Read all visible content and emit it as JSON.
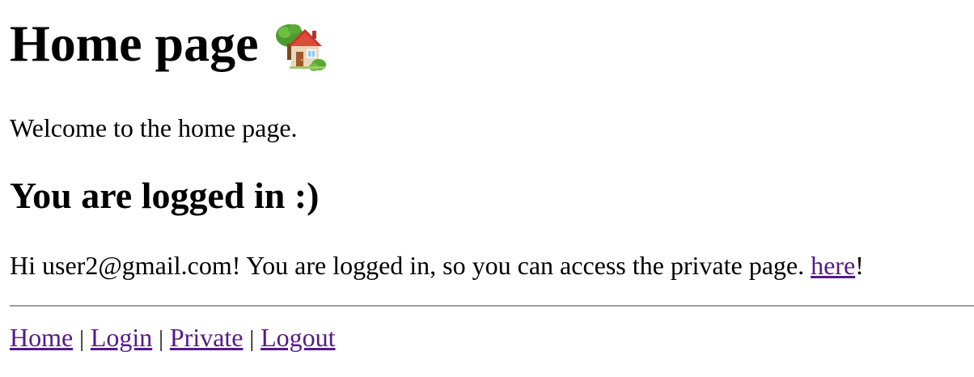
{
  "page": {
    "title": "Home page",
    "title_icon": "house-with-garden-icon",
    "intro": "Welcome to the home page.",
    "status_heading": "You are logged in :)",
    "greeting_before": "Hi user2@gmail.com! You are logged in, so you can access the private page. ",
    "greeting_link": "here",
    "greeting_after": "!"
  },
  "footer": {
    "links": [
      {
        "label": "Home"
      },
      {
        "label": "Login"
      },
      {
        "label": "Private"
      },
      {
        "label": "Logout"
      }
    ],
    "separator": "|"
  },
  "colors": {
    "link_visited": "#551a8b",
    "divider": "#9e9e9e"
  }
}
